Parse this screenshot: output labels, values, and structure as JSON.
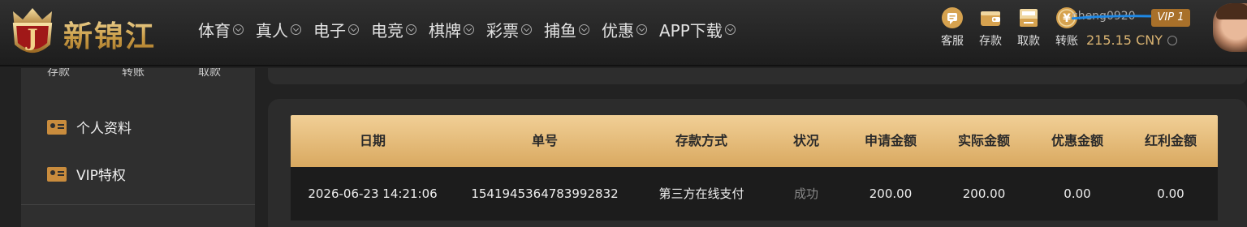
{
  "header": {
    "brand": "新锦江",
    "nav": [
      "体育",
      "真人",
      "电子",
      "电竞",
      "棋牌",
      "彩票",
      "捕鱼",
      "优惠",
      "APP下载"
    ],
    "tools": [
      {
        "label": "客服",
        "icon": "chat-icon"
      },
      {
        "label": "存款",
        "icon": "wallet-icon"
      },
      {
        "label": "取款",
        "icon": "atm-icon"
      },
      {
        "label": "转账",
        "icon": "yuan-coin-icon"
      }
    ],
    "username": "cheng0920",
    "vip": "VIP 1",
    "balance": "215.15 CNY"
  },
  "sidebar": {
    "tabs_cut": [
      "存款",
      "转账",
      "取款"
    ],
    "items": [
      "个人资料",
      "VIP特权"
    ]
  },
  "table": {
    "columns": [
      "日期",
      "单号",
      "存款方式",
      "状况",
      "申请金额",
      "实际金额",
      "优惠金额",
      "红利金额"
    ],
    "rows": [
      [
        "2026-06-23 14:21:06",
        "1541945364783992832",
        "第三方在线支付",
        "成功",
        "200.00",
        "200.00",
        "0.00",
        "0.00"
      ]
    ]
  },
  "colors": {
    "accent_gold": "#d9a960",
    "header_bg": "#262626",
    "page_bg": "#222222",
    "vip_badge": "#a8702a",
    "status_muted": "#888888"
  }
}
